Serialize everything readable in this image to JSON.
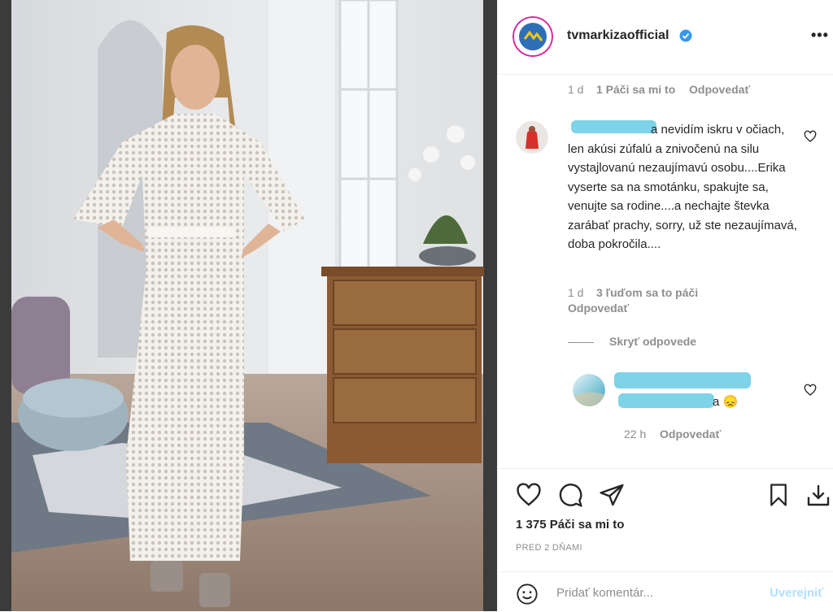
{
  "header": {
    "username": "tvmarkizaofficial",
    "verified_icon": "verified-badge-icon",
    "more_icon": "more-options-icon",
    "more_label": "•••"
  },
  "prev_comment_meta": {
    "time": "1 d",
    "likes": "1 Páči sa mi to",
    "reply": "Odpovedať"
  },
  "comment": {
    "text": "a nevidím iskru v očiach, len akúsi zúfalú a znivočenú na silu vystajlovanú nezaujímavú osobu....Erika vyserte sa na smotánku, spakujte sa, venujte sa rodine....a nechajte števka zarábať prachy, sorry, už ste nezaujímavá, doba pokročila....",
    "time": "1 d",
    "likes": "3 ľuďom sa to páči",
    "reply": "Odpovedať",
    "hide_replies": "Skryť odpovede"
  },
  "reply": {
    "text_end": "a 😞",
    "time": "22 h",
    "reply": "Odpovedať"
  },
  "actions": {
    "like_icon": "heart-icon",
    "comment_icon": "comment-icon",
    "share_icon": "share-icon",
    "save_icon": "bookmark-icon",
    "download_icon": "download-icon"
  },
  "likes_count": "1 375 Páči sa mi to",
  "date": "PRED 2 DŇAMI",
  "add_comment": {
    "emoji_icon": "emoji-icon",
    "placeholder": "Pridať komentár...",
    "post_label": "Uverejniť"
  },
  "colors": {
    "accent_blue": "#0095f6",
    "post_disabled": "#b2dffc",
    "blur_cyan": "#7ed3e8",
    "muted_text": "#8e8e8e"
  }
}
